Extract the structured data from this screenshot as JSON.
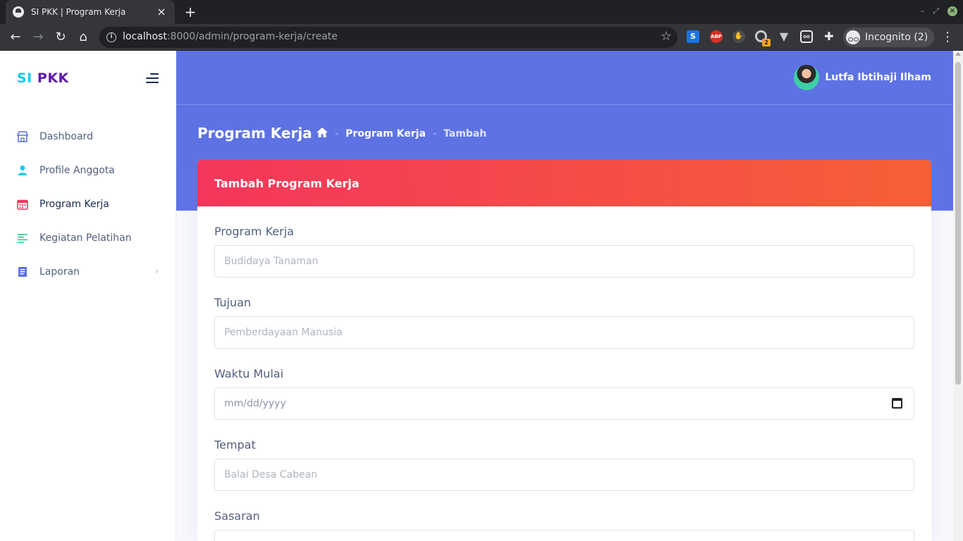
{
  "browser": {
    "tab_title": "SI PKK | Program Kerja",
    "tab_close": "×",
    "new_tab": "+",
    "url_host": "localhost",
    "url_rest": ":8000/admin/program-kerja/create",
    "incognito_label": "Incognito (2)",
    "ext_s": "S",
    "ext_abp": "ABP",
    "ext_badge": "2"
  },
  "sidebar": {
    "brand_si": "SI",
    "brand_pkk": "PKK",
    "items": [
      {
        "label": "Dashboard",
        "icon": "store-icon",
        "color": "#5e72e4"
      },
      {
        "label": "Profile Anggota",
        "icon": "user-icon",
        "color": "#11cdef"
      },
      {
        "label": "Program Kerja",
        "icon": "calendar-icon",
        "color": "#f5365c",
        "active": true
      },
      {
        "label": "Kegiatan Pelatihan",
        "icon": "align-left-icon",
        "color": "#2dce89"
      },
      {
        "label": "Laporan",
        "icon": "book-icon",
        "color": "#5e72e4",
        "has_submenu": true
      }
    ]
  },
  "header": {
    "user_name": "Lutfa Ibtihaji Ilham",
    "page_title": "Program Kerja",
    "breadcrumb": {
      "separator": "-",
      "link": "Program Kerja",
      "current": "Tambah"
    }
  },
  "form": {
    "title": "Tambah Program Kerja",
    "fields": [
      {
        "label": "Program Kerja",
        "placeholder": "Budidaya Tanaman",
        "value": ""
      },
      {
        "label": "Tujuan",
        "placeholder": "Pemberdayaan Manusia",
        "value": ""
      },
      {
        "label": "Waktu Mulai",
        "placeholder": "mm/dd/yyyy",
        "value": ""
      },
      {
        "label": "Tempat",
        "placeholder": "Balai Desa Cabean",
        "value": ""
      },
      {
        "label": "Sasaran",
        "placeholder": "",
        "value": ""
      }
    ]
  },
  "colors": {
    "primary": "#5e72e4",
    "danger": "#f5365c",
    "warning_gradient_end": "#f56036",
    "info": "#11cdef"
  }
}
